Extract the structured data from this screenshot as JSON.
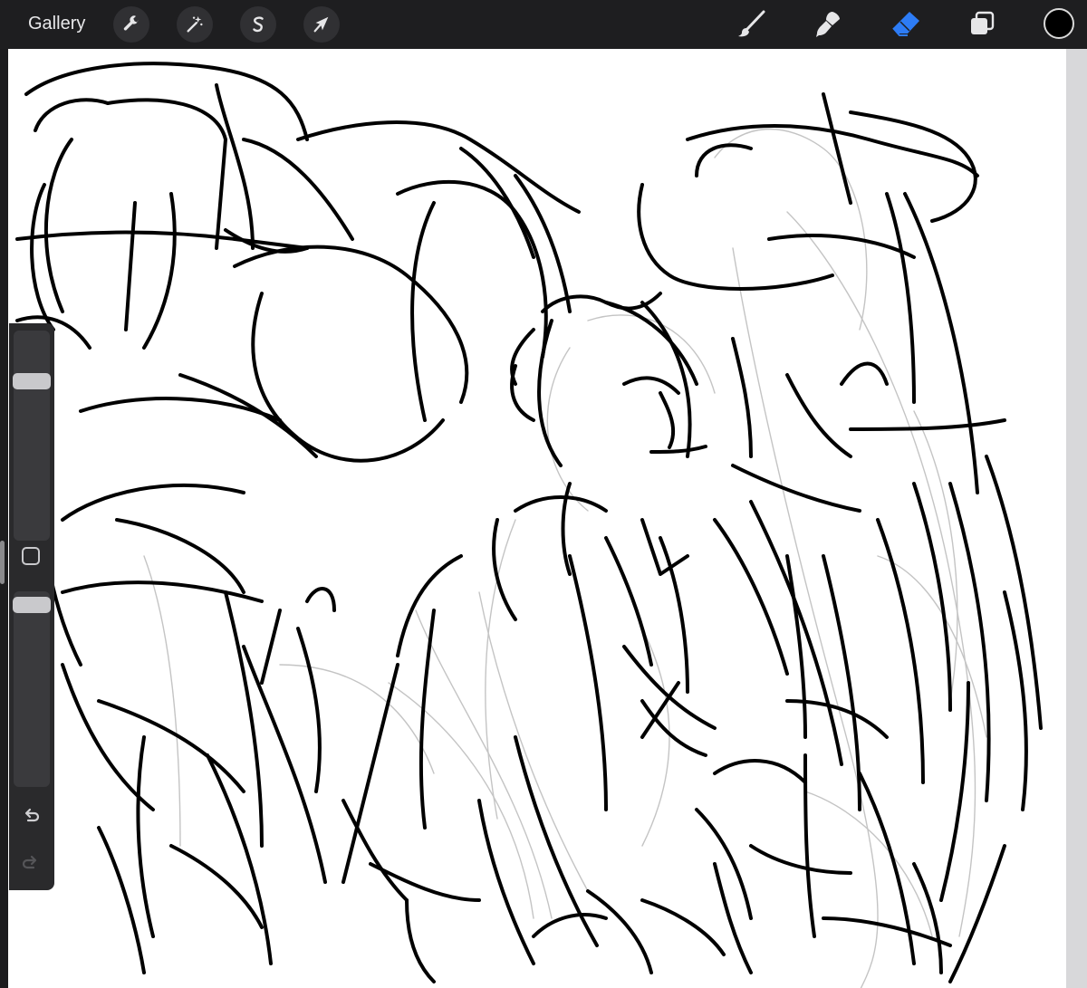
{
  "topbar": {
    "gallery_label": "Gallery",
    "left_tools": [
      {
        "name": "wrench-icon",
        "active": false
      },
      {
        "name": "magic-wand-icon",
        "active": false
      },
      {
        "name": "selection-s-icon",
        "active": false
      },
      {
        "name": "arrow-icon",
        "active": false
      }
    ],
    "right_tools": [
      {
        "name": "brush-icon",
        "active": false
      },
      {
        "name": "smudge-icon",
        "active": false
      },
      {
        "name": "eraser-icon",
        "active": true
      },
      {
        "name": "layers-icon",
        "active": false
      }
    ],
    "current_color": "#000000"
  },
  "sidebar": {
    "brush_size_level": 0.78,
    "opacity_level": 0.97,
    "modify_button": "square-modify-icon",
    "undo": "undo-icon",
    "redo": "redo-icon"
  },
  "colors": {
    "toolbar_bg": "#1e1e20",
    "active_tool": "#2d7cf6",
    "canvas_bg": "#ffffff"
  }
}
